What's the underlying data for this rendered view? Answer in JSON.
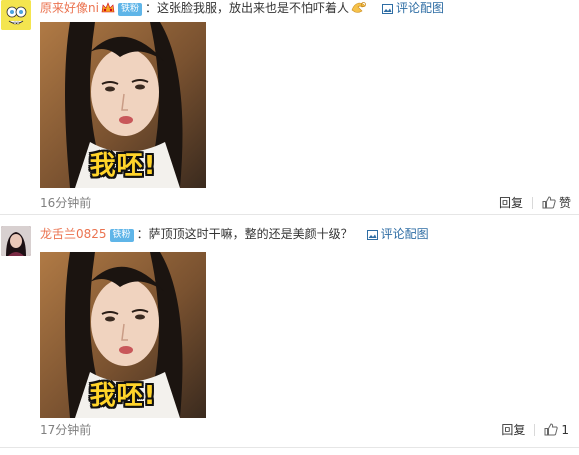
{
  "comments": [
    {
      "username": "原来好像ni",
      "badge": "铁粉",
      "text": "：这张脸我服，放出来也是不怕吓着人",
      "pic_link": "评论配图",
      "meme_caption": "我呸!",
      "time": "16分钟前",
      "reply": "回复",
      "like_label": "赞",
      "avatar": "spongebob-avatar",
      "emoji": "ok-hand-emoji"
    },
    {
      "username": "龙舌兰0825",
      "badge": "铁粉",
      "text": "：萨顶顶这时干嘛，整的还是美颜十级？",
      "pic_link": "评论配图",
      "meme_caption": "我呸!",
      "time": "17分钟前",
      "reply": "回复",
      "like_count": "1",
      "avatar": "woman-portrait-avatar"
    }
  ],
  "colors": {
    "username": "#eb7350",
    "badge": "#5fb5e8",
    "link": "#2e6da4",
    "meta": "#808080"
  }
}
